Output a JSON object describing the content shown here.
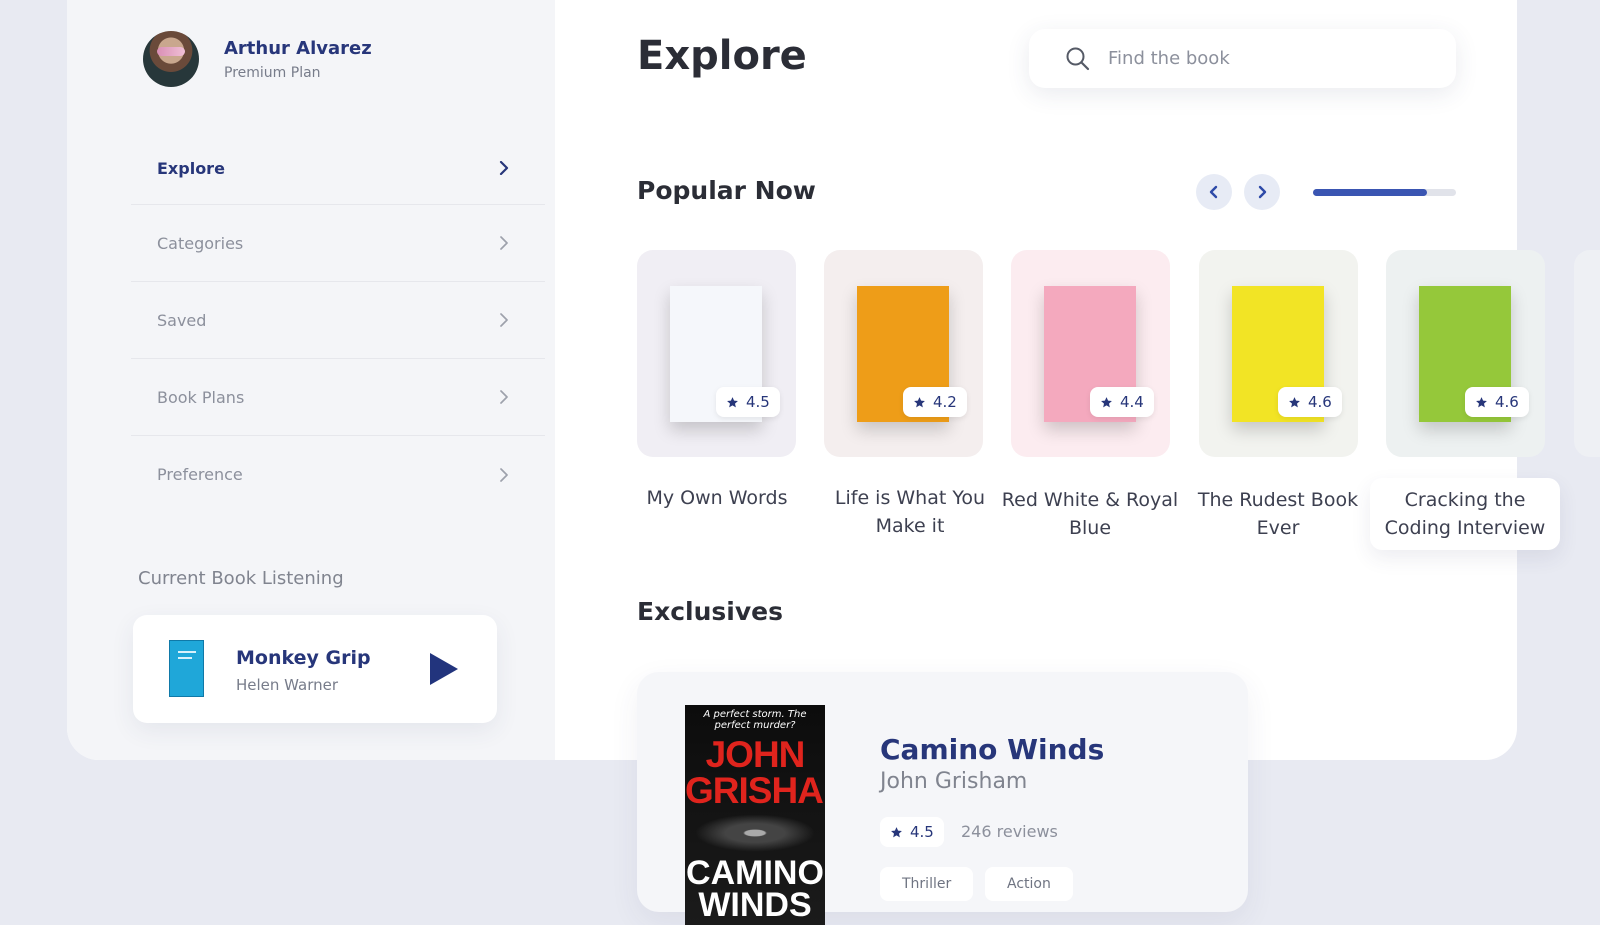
{
  "profile": {
    "name": "Arthur Alvarez",
    "plan": "Premium Plan"
  },
  "nav": [
    {
      "label": "Explore",
      "active": true
    },
    {
      "label": "Categories"
    },
    {
      "label": "Saved"
    },
    {
      "label": "Book Plans"
    },
    {
      "label": "Preference"
    }
  ],
  "current": {
    "title": "Current Book Listening",
    "book": "Monkey Grip",
    "author": "Helen Warner"
  },
  "main": {
    "title": "Explore"
  },
  "search": {
    "placeholder": "Find the book"
  },
  "popular": {
    "title": "Popular Now",
    "progress": 0.8
  },
  "books": [
    {
      "title": "My Own Words",
      "rating": "4.5",
      "card_color": "#f0eef4",
      "cover": "#f5f7fb"
    },
    {
      "title": "Life is What You Make it",
      "rating": "4.2",
      "card_color": "#f4eeee",
      "cover": "#ee9d18"
    },
    {
      "title": "Red White & Royal Blue",
      "rating": "4.4",
      "card_color": "#fcecf0",
      "cover": "#f4a9be"
    },
    {
      "title": "The Rudest Book Ever",
      "rating": "4.6",
      "card_color": "#f2f3ef",
      "cover": "#f2e425"
    },
    {
      "title": "Cracking the Coding Interview",
      "rating": "4.6",
      "card_color": "#edf1f1",
      "cover": "#95c83a"
    }
  ],
  "exclusives": {
    "title": "Exclusives",
    "book": {
      "title": "Camino Winds",
      "author": "John Grisham",
      "rating": "4.5",
      "reviews": "246 reviews",
      "tags": [
        "Thriller",
        "Action"
      ],
      "cover_tagline": "A perfect storm. The perfect murder?",
      "cover_author": "JOHN GRISHAM",
      "cover_title": "CAMINO WINDS"
    }
  },
  "colors": {
    "accent": "#27367a",
    "progress": "#3a55b2",
    "sidebar": "#f4f5f8",
    "background": "#e8eaf2"
  },
  "icons": [
    "search-icon",
    "chevron-right-icon",
    "chevron-left-icon",
    "star-icon",
    "play-icon"
  ]
}
